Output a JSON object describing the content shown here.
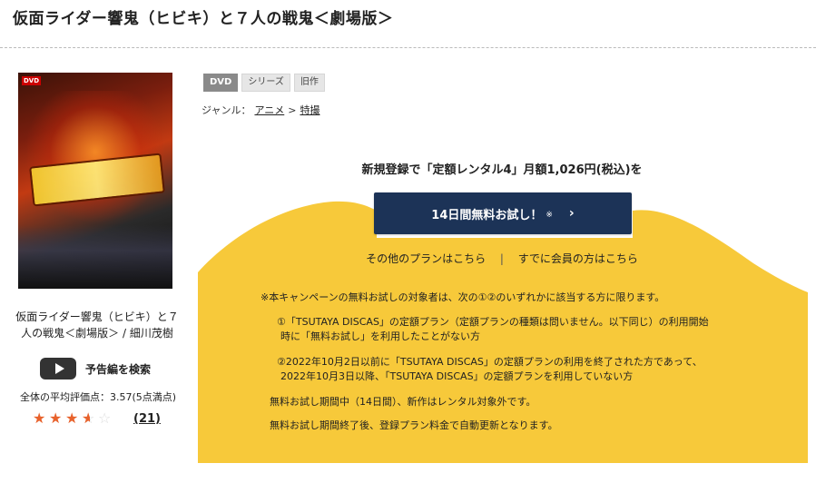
{
  "page": {
    "title": "仮面ライダー響鬼（ヒビキ）と７人の戦鬼＜劇場版＞"
  },
  "item": {
    "poster_label": "DVD",
    "caption_line1": "仮面ライダー響鬼（ヒビキ）と７",
    "caption_line2": "人の戦鬼＜劇場版＞ / 細川茂樹",
    "trailer_label": "予告編を検索",
    "avg_rating_text": "全体の平均評価点：3.57(5点満点)",
    "rating_value": 3.57,
    "rating_max": 5,
    "review_count": "(21)"
  },
  "badges": [
    "DVD",
    "シリーズ",
    "旧作"
  ],
  "genre": {
    "prefix": "ジャンル：",
    "items": [
      "アニメ",
      "特撮"
    ],
    "separator": ">"
  },
  "promo": {
    "headline": "新規登録で「定額レンタル4」月額1,026円(税込)を",
    "cta_label": "14日間無料お試し！",
    "cta_note": "※",
    "other_plans": "その他のプランはこちら",
    "separator": "|",
    "member_link": "すでに会員の方はこちら",
    "panel_color": "#f7c93a",
    "cta_color": "#1c3357"
  },
  "terms": {
    "intro": "※本キャンペーンの無料お試しの対象者は、次の①②のいずれかに該当する方に限ります。",
    "item1_line1": "①「TSUTAYA DISCAS」の定額プラン（定額プランの種類は問いません。以下同じ）の利用開始",
    "item1_line2": "時に「無料お試し」を利用したことがない方",
    "item2_line1": "②2022年10月2日以前に「TSUTAYA DISCAS」の定額プランの利用を終了された方であって、",
    "item2_line2": "2022年10月3日以降、「TSUTAYA DISCAS」の定額プランを利用していない方",
    "note1": "無料お試し期間中（14日間）、新作はレンタル対象外です。",
    "note2": "無料お試し期間終了後、登録プラン料金で自動更新となります。"
  }
}
